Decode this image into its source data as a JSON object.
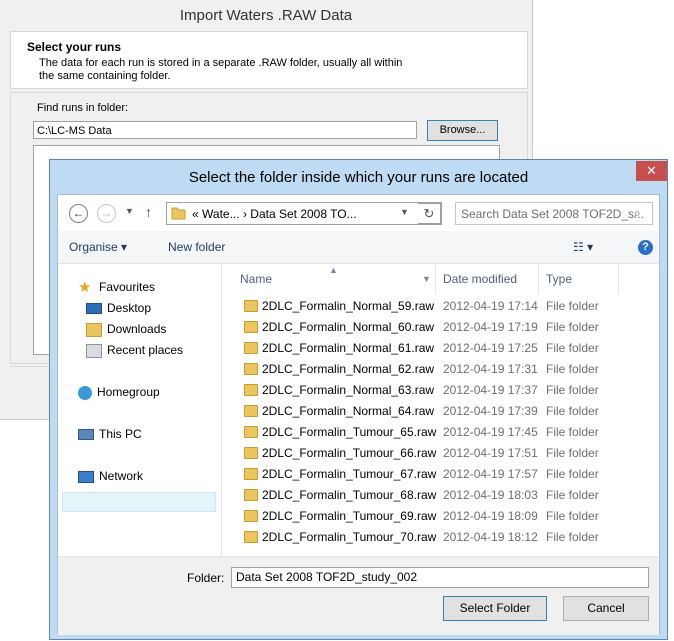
{
  "wizard": {
    "title": "Import Waters .RAW Data",
    "heading": "Select your runs",
    "description": "The data for each run is stored in a separate .RAW folder, usually all within the same containing folder.",
    "find_label": "Find runs in folder:",
    "find_value": "C:\\LC-MS Data",
    "browse_label": "Browse..."
  },
  "dialog": {
    "title": "Select the folder inside which your runs are located",
    "close_label": "✕",
    "address": {
      "prefix": "«",
      "crumb1": "Wate...",
      "sep": "›",
      "crumb2": "Data Set 2008 TO..."
    },
    "search_placeholder": "Search Data Set 2008 TOF2D_s...",
    "toolbar": {
      "organise_label": "Organise ▾",
      "new_folder_label": "New folder",
      "view_label": "☷ ▾",
      "help_label": "?"
    },
    "nav": {
      "favourites": "Favourites",
      "desktop": "Desktop",
      "downloads": "Downloads",
      "recent": "Recent places",
      "homegroup": "Homegroup",
      "thispc": "This PC",
      "network": "Network"
    },
    "columns": {
      "name": "Name",
      "date": "Date modified",
      "type": "Type"
    },
    "files": [
      {
        "name": "2DLC_Formalin_Normal_59.raw",
        "date": "2012-04-19 17:14",
        "type": "File folder"
      },
      {
        "name": "2DLC_Formalin_Normal_60.raw",
        "date": "2012-04-19 17:19",
        "type": "File folder"
      },
      {
        "name": "2DLC_Formalin_Normal_61.raw",
        "date": "2012-04-19 17:25",
        "type": "File folder"
      },
      {
        "name": "2DLC_Formalin_Normal_62.raw",
        "date": "2012-04-19 17:31",
        "type": "File folder"
      },
      {
        "name": "2DLC_Formalin_Normal_63.raw",
        "date": "2012-04-19 17:37",
        "type": "File folder"
      },
      {
        "name": "2DLC_Formalin_Normal_64.raw",
        "date": "2012-04-19 17:39",
        "type": "File folder"
      },
      {
        "name": "2DLC_Formalin_Tumour_65.raw",
        "date": "2012-04-19 17:45",
        "type": "File folder"
      },
      {
        "name": "2DLC_Formalin_Tumour_66.raw",
        "date": "2012-04-19 17:51",
        "type": "File folder"
      },
      {
        "name": "2DLC_Formalin_Tumour_67.raw",
        "date": "2012-04-19 17:57",
        "type": "File folder"
      },
      {
        "name": "2DLC_Formalin_Tumour_68.raw",
        "date": "2012-04-19 18:03",
        "type": "File folder"
      },
      {
        "name": "2DLC_Formalin_Tumour_69.raw",
        "date": "2012-04-19 18:09",
        "type": "File folder"
      },
      {
        "name": "2DLC_Formalin_Tumour_70.raw",
        "date": "2012-04-19 18:12",
        "type": "File folder"
      }
    ],
    "folder_label": "Folder:",
    "folder_value": "Data Set 2008 TOF2D_study_002",
    "select_label": "Select Folder",
    "cancel_label": "Cancel"
  }
}
